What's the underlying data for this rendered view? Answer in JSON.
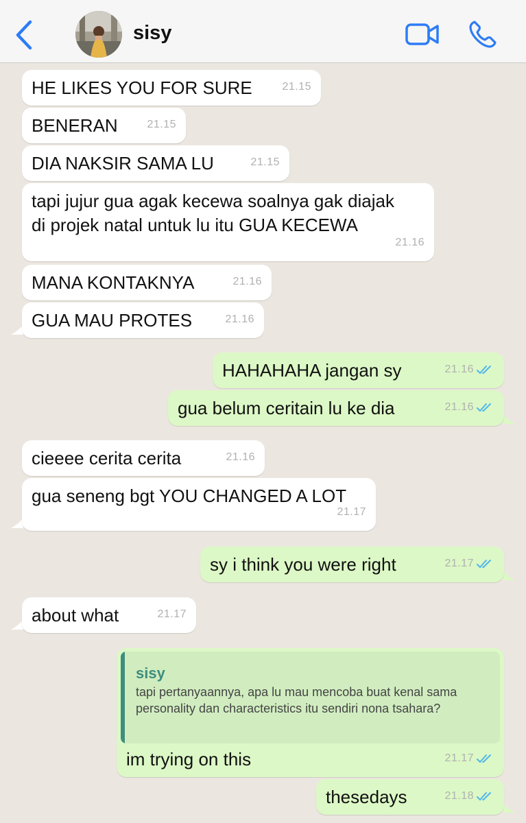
{
  "header": {
    "contact_name": "sisy"
  },
  "colors": {
    "accent": "#2d7cf6",
    "incoming_bubble": "#ffffff",
    "outgoing_bubble": "#dcf8c6",
    "read_ticks": "#4fb6ec",
    "chat_background": "#ebe7e0"
  },
  "messages": [
    {
      "text": "HE LIKES YOU FOR SURE",
      "time": "21.15"
    },
    {
      "text": "BENERAN",
      "time": "21.15"
    },
    {
      "text": "DIA NAKSIR SAMA LU",
      "time": "21.15"
    },
    {
      "text": "tapi jujur gua agak kecewa soalnya gak diajak\ndi projek natal untuk lu itu GUA KECEWA",
      "time": "21.16"
    },
    {
      "text": "MANA KONTAKNYA",
      "time": "21.16"
    },
    {
      "text": "GUA MAU PROTES",
      "time": "21.16"
    },
    {
      "text": "HAHAHAHA jangan sy",
      "time": "21.16"
    },
    {
      "text": "gua belum ceritain lu ke dia",
      "time": "21.16"
    },
    {
      "text": "cieeee cerita cerita",
      "time": "21.16"
    },
    {
      "text": "gua seneng bgt YOU CHANGED A LOT",
      "time": "21.17"
    },
    {
      "text": "sy i think you were right",
      "time": "21.17"
    },
    {
      "text": "about what",
      "time": "21.17"
    },
    {
      "text": "im trying on this",
      "time": "21.17",
      "quote": {
        "name": "sisy",
        "text": "tapi pertanyaannya, apa lu mau mencoba buat kenal sama personality dan characteristics itu sendiri nona tsahara?"
      }
    },
    {
      "text": "thesedays",
      "time": "21.18"
    }
  ]
}
